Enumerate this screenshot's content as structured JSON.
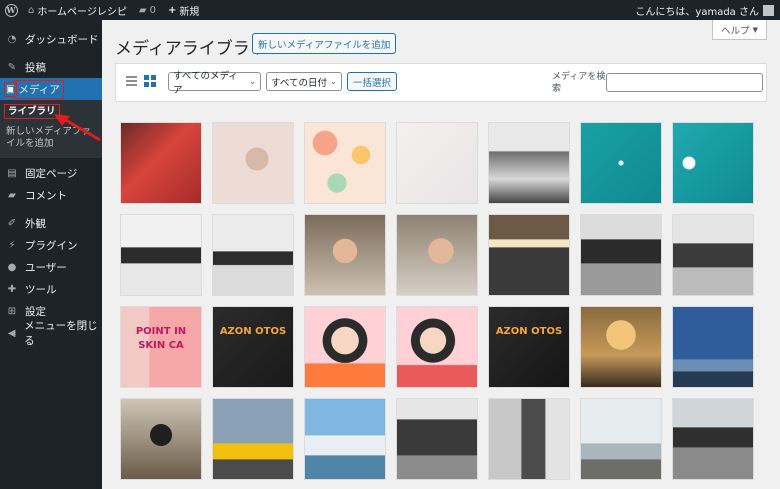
{
  "adminbar": {
    "site_name": "ホームページレシピ",
    "comments_count": "0",
    "new_label": "新規",
    "greeting": "こんにちは、yamada さん"
  },
  "sidebar": {
    "items": [
      {
        "label": "ダッシュボード",
        "icon": "dashboard-icon"
      },
      {
        "label": "投稿",
        "icon": "pin-icon"
      },
      {
        "label": "メディア",
        "icon": "media-icon"
      },
      {
        "label": "固定ページ",
        "icon": "page-icon"
      },
      {
        "label": "コメント",
        "icon": "comment-icon"
      },
      {
        "label": "外観",
        "icon": "brush-icon"
      },
      {
        "label": "プラグイン",
        "icon": "plugin-icon"
      },
      {
        "label": "ユーザー",
        "icon": "user-icon"
      },
      {
        "label": "ツール",
        "icon": "wrench-icon"
      },
      {
        "label": "設定",
        "icon": "settings-icon"
      },
      {
        "label": "メニューを閉じる",
        "icon": "collapse-icon"
      }
    ],
    "submenu": [
      {
        "label": "ライブラリ"
      },
      {
        "label": "新しいメディアファイルを追加"
      }
    ]
  },
  "main": {
    "help_label": "ヘルプ",
    "title": "メディアライブラリ",
    "add_new_label": "新しいメディアファイルを追加",
    "filter_type": "すべてのメディア",
    "filter_date": "すべての日付",
    "bulk_select_label": "一括選択",
    "search_label": "メディアを検索",
    "search_value": ""
  },
  "tiles": [
    {
      "name": "red-fish"
    },
    {
      "name": "hand-bottle"
    },
    {
      "name": "flower-pattern"
    },
    {
      "name": "light-texture"
    },
    {
      "name": "office-bw"
    },
    {
      "name": "ocean-surfer-1"
    },
    {
      "name": "ocean-surfer-2"
    },
    {
      "name": "desk-keyboard-1"
    },
    {
      "name": "desk-keyboard-2"
    },
    {
      "name": "woman-laughing-1"
    },
    {
      "name": "woman-laughing-2"
    },
    {
      "name": "office-lights"
    },
    {
      "name": "office-monitors"
    },
    {
      "name": "office-monitors-bw"
    },
    {
      "name": "point-banner",
      "text": "POINT IN SKIN CA"
    },
    {
      "name": "amazon-photos-1",
      "text": "AZON OTOS"
    },
    {
      "name": "avatar-woman-glasses"
    },
    {
      "name": "avatar-woman-tea"
    },
    {
      "name": "amazon-photos-2",
      "text": "AZON OTOS"
    },
    {
      "name": "grand-central"
    },
    {
      "name": "statue-liberty"
    },
    {
      "name": "photographer"
    },
    {
      "name": "street-taxis"
    },
    {
      "name": "harbor-city"
    },
    {
      "name": "subway-bw"
    },
    {
      "name": "woman-window"
    },
    {
      "name": "misty-beach"
    },
    {
      "name": "cafe-window"
    }
  ]
}
